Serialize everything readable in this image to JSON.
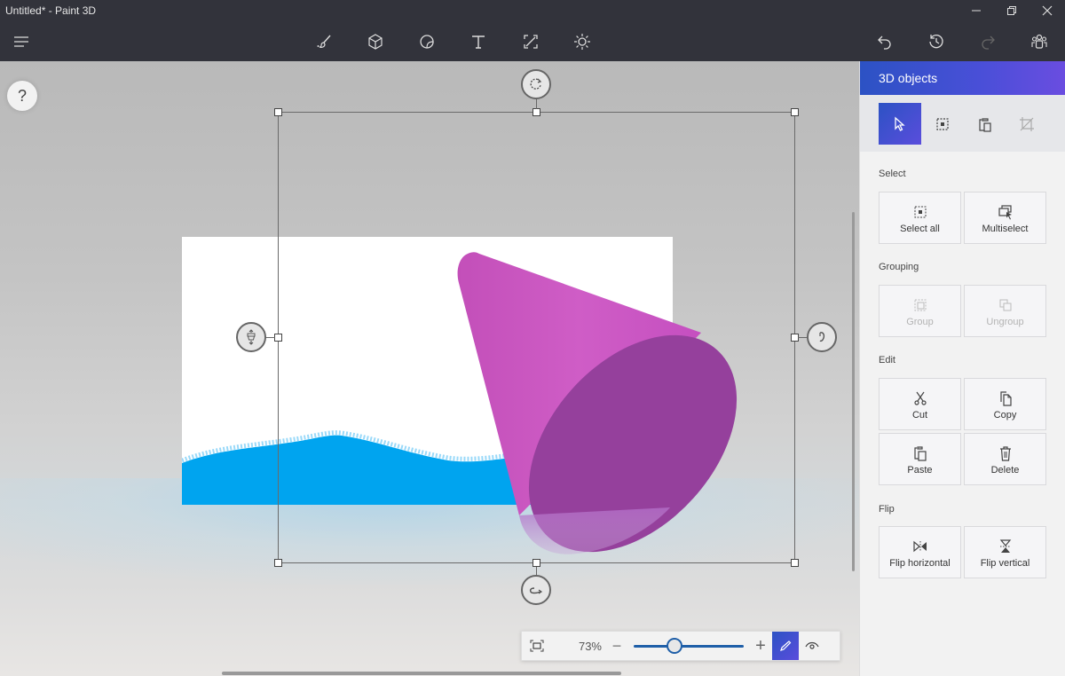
{
  "window": {
    "title": "Untitled* - Paint 3D",
    "minimize_icon": "minimize-icon",
    "maximize_icon": "restore-icon",
    "close_icon": "close-icon"
  },
  "toolbar": {
    "menu_icon": "hamburger-menu-icon",
    "tools": [
      {
        "name": "Brushes",
        "icon": "brush-icon"
      },
      {
        "name": "3D shapes",
        "icon": "cube-icon"
      },
      {
        "name": "Stickers",
        "icon": "sticker-icon"
      },
      {
        "name": "Text",
        "icon": "text-icon"
      },
      {
        "name": "Canvas",
        "icon": "canvas-resize-icon"
      },
      {
        "name": "Effects",
        "icon": "sun-icon"
      }
    ],
    "right": [
      {
        "name": "Undo",
        "icon": "undo-icon"
      },
      {
        "name": "History",
        "icon": "history-icon"
      },
      {
        "name": "Redo",
        "icon": "redo-icon",
        "disabled": true
      },
      {
        "name": "Remix 3D",
        "icon": "community-icon"
      }
    ]
  },
  "canvas": {
    "help_label": "?",
    "object_color": "#cc55c8",
    "object_base_color": "#95409c",
    "water_color": "#00a4ef"
  },
  "zoom": {
    "value_label": "73%",
    "value_percent": 73,
    "slider_fraction": 0.37,
    "minus_label": "−",
    "plus_label": "+"
  },
  "panel": {
    "title": "3D objects",
    "tabs": [
      {
        "name": "Select",
        "icon": "cursor-icon",
        "active": true
      },
      {
        "name": "Select region",
        "icon": "marquee-icon"
      },
      {
        "name": "Paste",
        "icon": "clipboard-icon"
      },
      {
        "name": "Crop",
        "icon": "crop-icon",
        "disabled": true
      }
    ],
    "sections": {
      "select": {
        "label": "Select",
        "buttons": [
          {
            "label": "Select all"
          },
          {
            "label": "Multiselect"
          }
        ]
      },
      "grouping": {
        "label": "Grouping",
        "buttons": [
          {
            "label": "Group",
            "disabled": true
          },
          {
            "label": "Ungroup",
            "disabled": true
          }
        ]
      },
      "edit": {
        "label": "Edit",
        "buttons": [
          {
            "label": "Cut"
          },
          {
            "label": "Copy"
          },
          {
            "label": "Paste"
          },
          {
            "label": "Delete"
          }
        ]
      },
      "flip": {
        "label": "Flip",
        "buttons": [
          {
            "label": "Flip horizontal"
          },
          {
            "label": "Flip vertical"
          }
        ]
      }
    }
  }
}
